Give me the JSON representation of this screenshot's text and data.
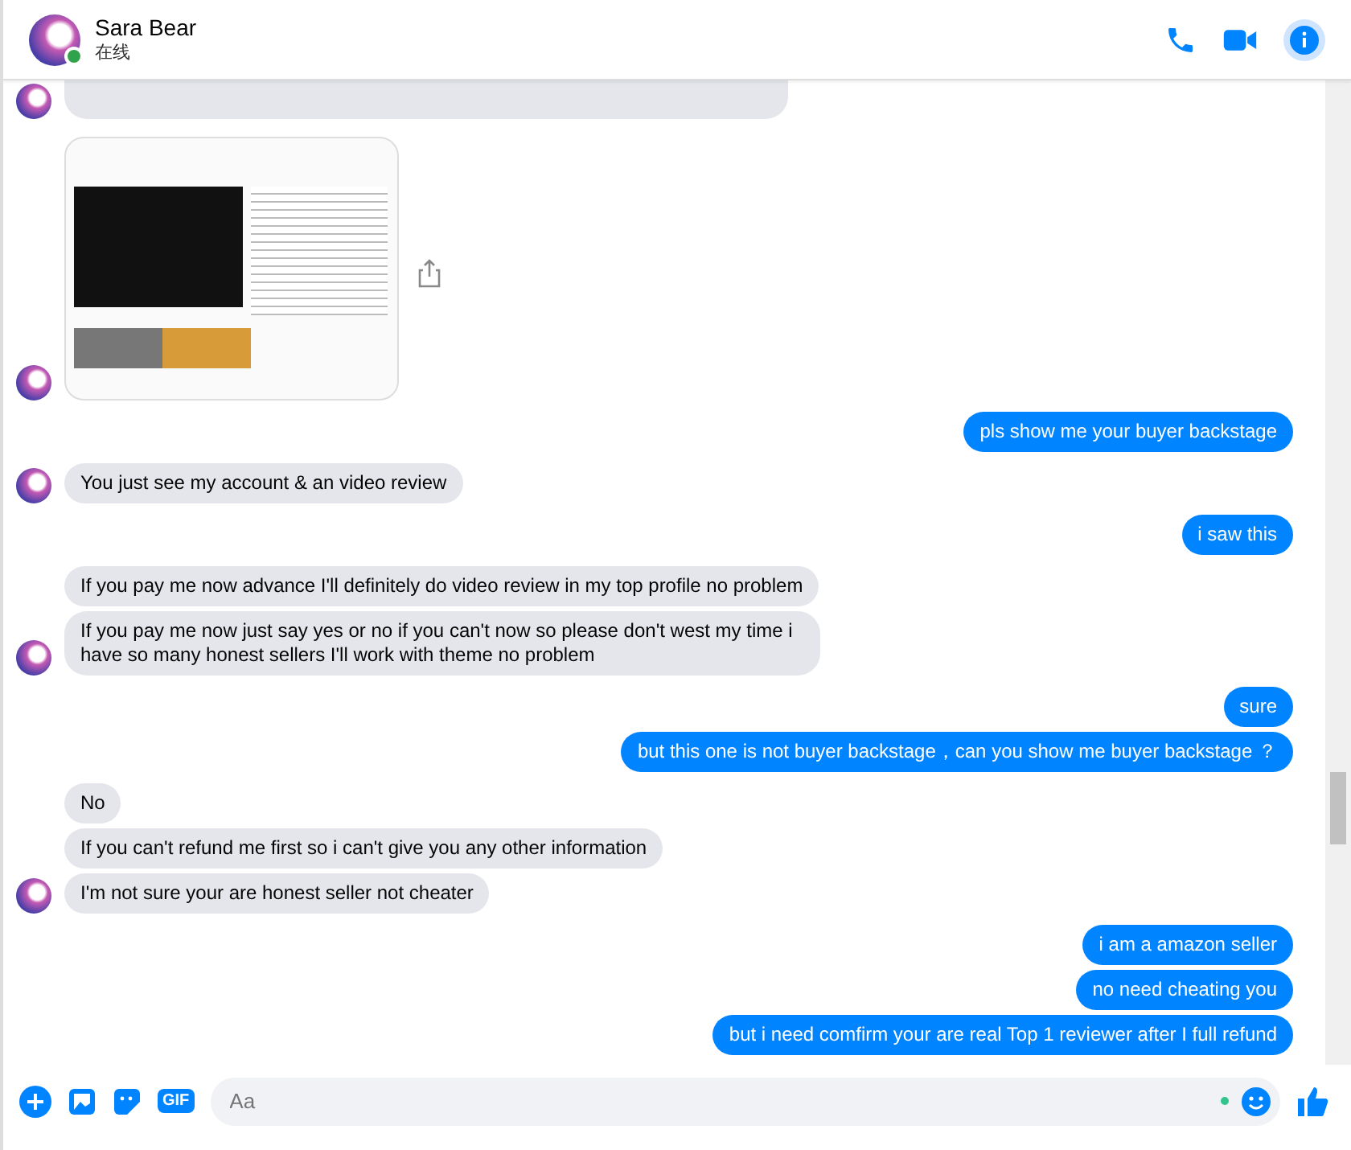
{
  "header": {
    "name": "Sara Bear",
    "status": "在线",
    "online": true
  },
  "messages": [
    {
      "kind": "clipped",
      "outgoing": false,
      "avatar": true
    },
    {
      "kind": "image",
      "outgoing": false,
      "avatar": true
    },
    {
      "kind": "text",
      "outgoing": true,
      "text": "pls show me your buyer backstage"
    },
    {
      "kind": "text",
      "outgoing": false,
      "text": "You just see my account & an video review",
      "avatar": true
    },
    {
      "kind": "text",
      "outgoing": true,
      "text": "i saw this"
    },
    {
      "kind": "text",
      "outgoing": false,
      "text": "If you pay me now advance I'll definitely do video review in my top profile no problem",
      "avatar": false
    },
    {
      "kind": "text",
      "outgoing": false,
      "text": "If you pay me now just say yes or no if you can't now so please don't west my time i have so many honest sellers I'll work with theme no problem",
      "avatar": true
    },
    {
      "kind": "text",
      "outgoing": true,
      "text": "sure"
    },
    {
      "kind": "text",
      "outgoing": true,
      "text": "but this one is not buyer backstage，can you show me buyer backstage ？"
    },
    {
      "kind": "text",
      "outgoing": false,
      "text": "No",
      "avatar": false
    },
    {
      "kind": "text",
      "outgoing": false,
      "text": "If you can't refund me first so i can't give you any other information",
      "avatar": false
    },
    {
      "kind": "text",
      "outgoing": false,
      "text": "I'm not sure your are honest seller not cheater",
      "avatar": true
    },
    {
      "kind": "text",
      "outgoing": true,
      "text": "i am a amazon seller"
    },
    {
      "kind": "text",
      "outgoing": true,
      "text": "no need cheating you"
    },
    {
      "kind": "text",
      "outgoing": true,
      "text": "but i need comfirm your are real Top 1 reviewer after I full refund"
    }
  ],
  "composer": {
    "placeholder": "Aa",
    "gif_label": "GIF"
  }
}
